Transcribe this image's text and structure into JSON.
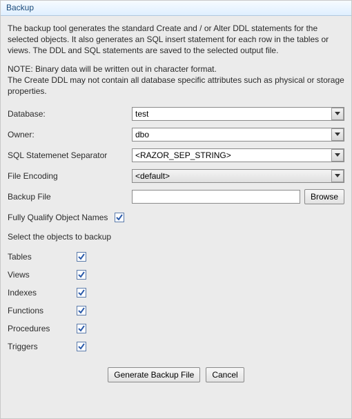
{
  "window": {
    "title": "Backup"
  },
  "description": "The backup tool generates the standard Create and / or Alter DDL statements for the selected objects. It also generates an SQL insert statement for each row in the tables or views. The DDL and SQL statements are saved to the selected output file.",
  "note": "NOTE: Binary data will be written out in character format.\nThe Create DDL may not contain all database specific attributes such as physical or storage properties.",
  "form": {
    "database": {
      "label": "Database:",
      "value": "test"
    },
    "owner": {
      "label": "Owner:",
      "value": "dbo"
    },
    "separator": {
      "label": "SQL Statemenet Separator",
      "value": "<RAZOR_SEP_STRING>"
    },
    "encoding": {
      "label": "File Encoding",
      "value": "<default>"
    },
    "backupfile": {
      "label": "Backup File",
      "value": "",
      "browse": "Browse"
    },
    "fqn": {
      "label": "Fully Qualify Object Names",
      "checked": true
    }
  },
  "objects": {
    "heading": "Select the objects to backup",
    "items": [
      {
        "label": "Tables",
        "checked": true
      },
      {
        "label": "Views",
        "checked": true
      },
      {
        "label": "Indexes",
        "checked": true
      },
      {
        "label": "Functions",
        "checked": true
      },
      {
        "label": "Procedures",
        "checked": true
      },
      {
        "label": "Triggers",
        "checked": true
      }
    ]
  },
  "buttons": {
    "generate": "Generate Backup File",
    "cancel": "Cancel"
  }
}
